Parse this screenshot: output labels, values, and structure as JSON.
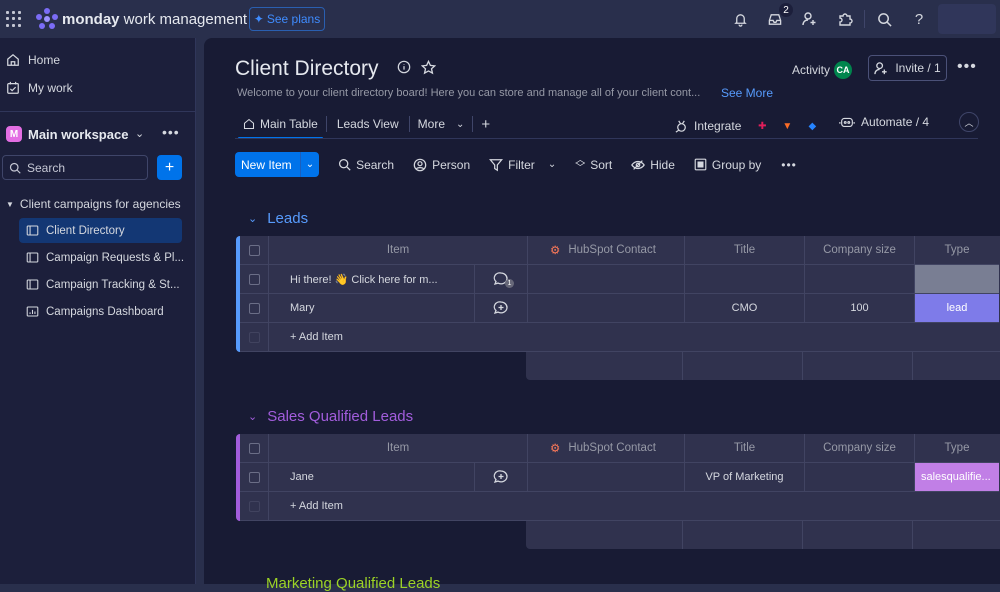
{
  "app": {
    "brand_bold": "monday",
    "brand_rest": " work management",
    "see_plans_label": "See plans",
    "inbox_badge": "2",
    "user_initials": "CA",
    "colors": {
      "accent": "#0073ea",
      "leads": "#579bfc",
      "sql": "#a25ddc",
      "mql": "#9cd326",
      "lead_label": "#7e7be9",
      "sql_label": "#c17fe6",
      "empty_label": "#797e93"
    }
  },
  "topbar_icons": [
    "bell-icon",
    "inbox-icon",
    "invite-member-icon",
    "apps-icon",
    "search-icon",
    "help-icon"
  ],
  "sidebar": {
    "home": "Home",
    "my_work": "My work",
    "workspace": {
      "initial": "M",
      "name": "Main workspace"
    },
    "search_placeholder": "Search",
    "folder": "Client campaigns for agencies",
    "boards": [
      {
        "label": "Client Directory",
        "active": true,
        "icon": "board-icon"
      },
      {
        "label": "Campaign Requests & Pl...",
        "icon": "board-icon"
      },
      {
        "label": "Campaign Tracking & St...",
        "icon": "board-icon"
      },
      {
        "label": "Campaigns Dashboard",
        "icon": "dashboard-icon"
      }
    ]
  },
  "board": {
    "title": "Client Directory",
    "description": "Welcome to your client directory board! Here you can store and manage all of your client cont...",
    "see_more": "See More",
    "activity_label": "Activity",
    "activity_initials": "CA",
    "invite_label": "Invite / 1",
    "tabs": [
      {
        "label": "Main Table",
        "active": true
      },
      {
        "label": "Leads View"
      },
      {
        "label": "More"
      }
    ],
    "integrate_label": "Integrate",
    "automate_label": "Automate / 4",
    "toolbar": {
      "new_item": "New Item",
      "search": "Search",
      "person": "Person",
      "filter": "Filter",
      "sort": "Sort",
      "hide": "Hide",
      "group_by": "Group by"
    },
    "columns": {
      "item": "Item",
      "hubspot": "HubSpot Contact",
      "title": "Title",
      "company_size": "Company size",
      "type": "Type"
    },
    "add_item": "+ Add Item",
    "groups": [
      {
        "name": "Leads",
        "rows": [
          {
            "item": "Hi there! 👋 Click here for m...",
            "updates": "1",
            "hubspot": "",
            "title": "",
            "company_size": "",
            "type": ""
          },
          {
            "item": "Mary",
            "hubspot": "",
            "title": "CMO",
            "company_size": "100",
            "type": "lead"
          }
        ]
      },
      {
        "name": "Sales Qualified Leads",
        "rows": [
          {
            "item": "Jane",
            "hubspot": "",
            "title": "VP of Marketing",
            "company_size": "",
            "type": "salesqualifie..."
          }
        ]
      },
      {
        "name": "Marketing Qualified Leads",
        "rows": []
      }
    ]
  }
}
